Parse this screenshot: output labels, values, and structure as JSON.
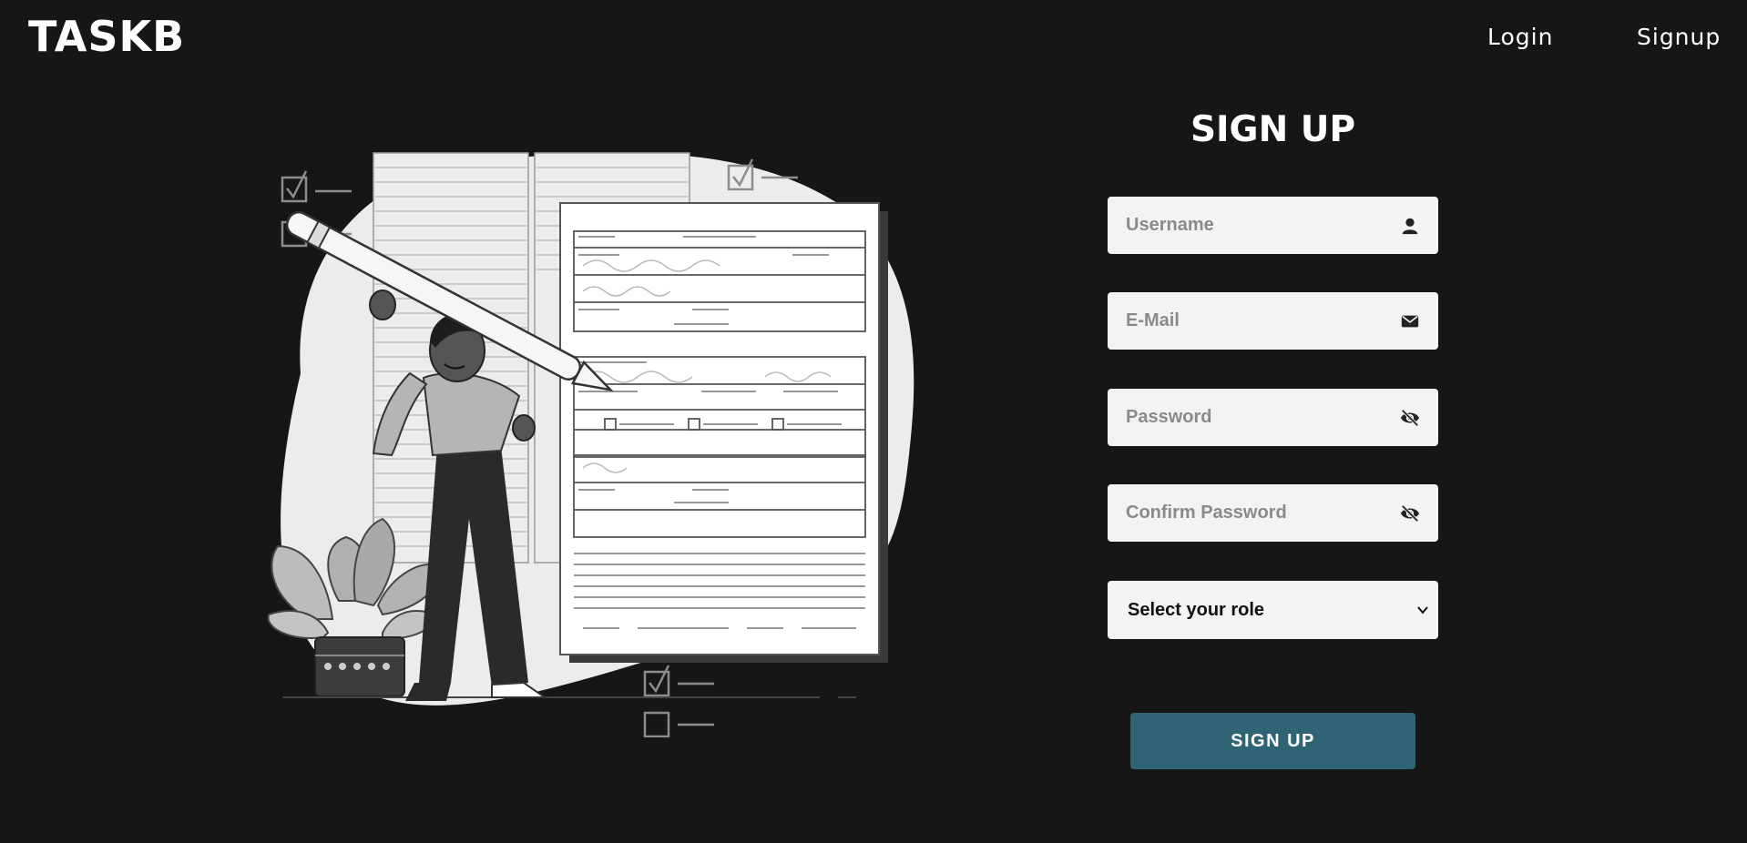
{
  "brand": {
    "logo_text": "TASKB"
  },
  "nav": {
    "login_label": "Login",
    "signup_label": "Signup"
  },
  "form": {
    "title": "SIGN UP",
    "username": {
      "placeholder": "Username",
      "icon": "user-icon"
    },
    "email": {
      "placeholder": "E-Mail",
      "icon": "envelope-icon"
    },
    "password": {
      "placeholder": "Password",
      "icon": "eye-slash-icon"
    },
    "confirm_password": {
      "placeholder": "Confirm Password",
      "icon": "eye-slash-icon"
    },
    "role": {
      "selected": "Select your role",
      "icon": "chevron-down-icon"
    },
    "submit_label": "SIGN UP"
  },
  "colors": {
    "background": "#161616",
    "field_background": "#f3f3f3",
    "button": "#2f6475",
    "text": "#ffffff"
  }
}
